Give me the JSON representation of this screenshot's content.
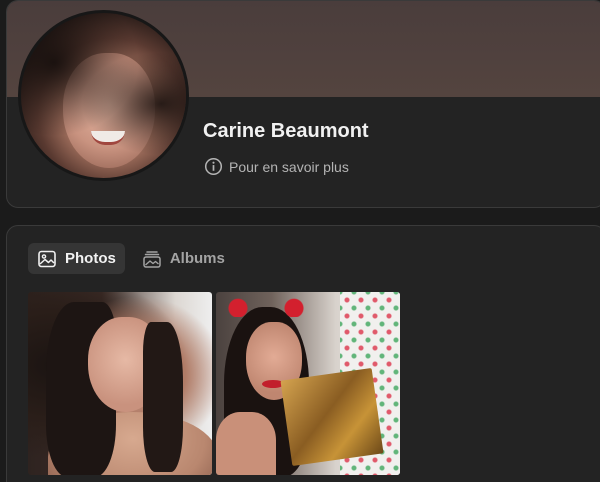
{
  "profile": {
    "name": "Carine Beaumont",
    "learn_more": "Pour en savoir plus"
  },
  "photos_section": {
    "tabs": [
      {
        "label": "Photos",
        "icon": "image-icon",
        "active": true
      },
      {
        "label": "Albums",
        "icon": "albums-icon",
        "active": false
      }
    ],
    "photo_count_visible": 2
  },
  "colors": {
    "background": "#1b1b1b",
    "card": "#232323",
    "cover": "#4f403d",
    "active_tab": "#353535"
  }
}
